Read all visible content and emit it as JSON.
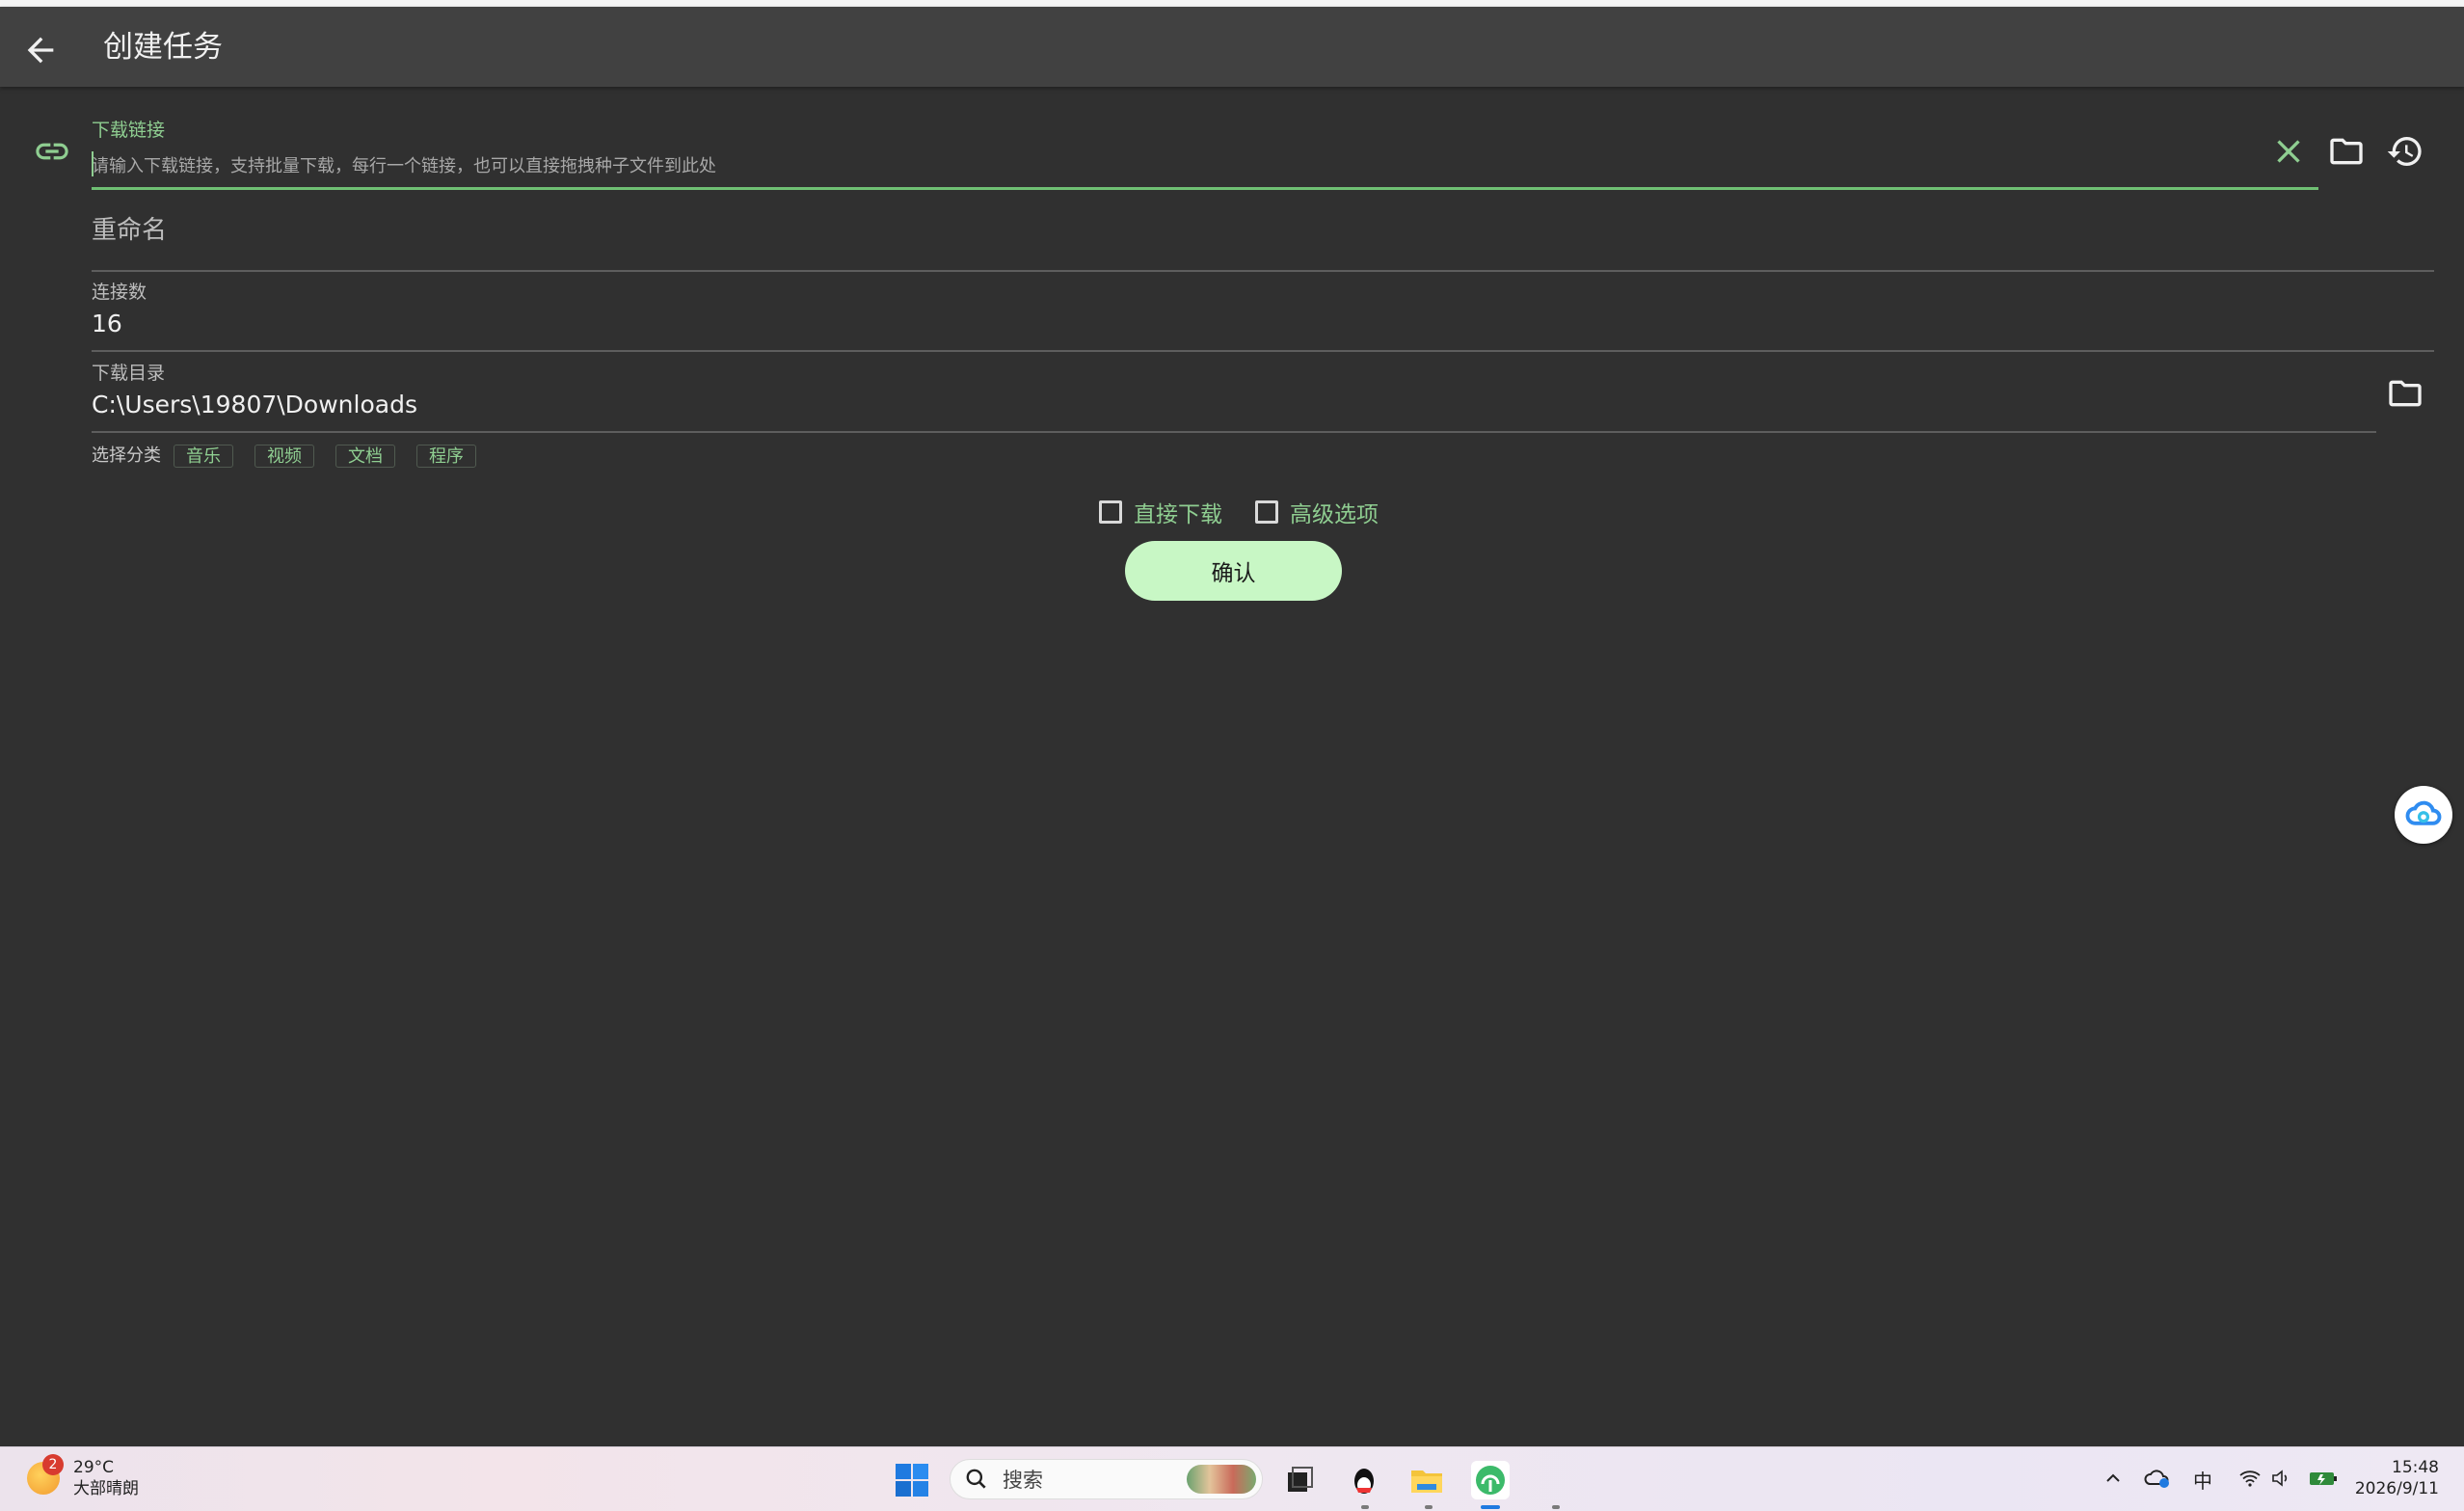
{
  "app": {
    "title": "创建任务"
  },
  "form": {
    "url_label": "下载链接",
    "url_placeholder": "请输入下载链接，支持批量下载，每行一个链接，也可以直接拖拽种子文件到此处",
    "rename_placeholder": "重命名",
    "connections_label": "连接数",
    "connections_value": "16",
    "directory_label": "下载目录",
    "directory_value": "C:\\Users\\19807\\Downloads",
    "category_label": "选择分类",
    "categories": [
      "音乐",
      "视频",
      "文档",
      "程序"
    ],
    "direct_download_label": "直接下载",
    "advanced_options_label": "高级选项",
    "confirm_label": "确认"
  },
  "colors": {
    "accent": "#8fce91",
    "confirm_bg": "#c8f7c5",
    "background": "#303030",
    "appbar": "#414141"
  },
  "icons": {
    "back": "arrow-left-icon",
    "link": "link-icon",
    "clear": "close-icon",
    "folder": "folder-icon",
    "history": "history-icon",
    "cloud": "cloud-sync-icon"
  },
  "taskbar": {
    "weather_badge": "2",
    "weather_temp": "29°C",
    "weather_desc": "大部晴朗",
    "search_label": "搜索",
    "ime": "中",
    "time": "15:48",
    "date": "2026/9/11"
  }
}
